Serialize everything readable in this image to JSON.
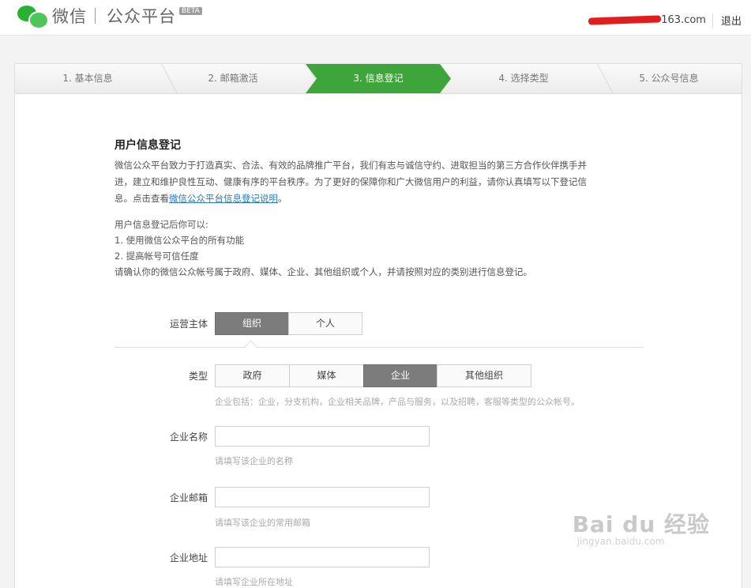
{
  "header": {
    "brand": "微信",
    "product": "公众平台",
    "beta": "BETA",
    "account_suffix": "163.com",
    "logout": "退出"
  },
  "steps": [
    {
      "label": "1. 基本信息",
      "active": false
    },
    {
      "label": "2. 邮箱激活",
      "active": false
    },
    {
      "label": "3. 信息登记",
      "active": true
    },
    {
      "label": "4. 选择类型",
      "active": false
    },
    {
      "label": "5. 公众号信息",
      "active": false
    }
  ],
  "intro": {
    "title": "用户信息登记",
    "para_line1": "微信公众平台致力于打造真实、合法、有效的品牌推广平台，我们有志与诚信守约、进取担当的第三方合作伙伴携手并",
    "para_line2": "进，建立和维护良性互动、健康有序的平台秩序。为了更好的保障你和广大微信用户的利益，请你认真填写以下登记信",
    "para_line3_pre": "息。点击查看",
    "para_link": "微信公众平台信息登记说明",
    "para_line3_post": "。",
    "list_intro": "用户信息登记后你可以:",
    "list_item1": "1. 使用微信公众平台的所有功能",
    "list_item2": "2. 提高帐号可信任度",
    "list_note": "请确认你的微信公众帐号属于政府、媒体、企业、其他组织或个人，并请按照对应的类别进行信息登记。"
  },
  "form": {
    "entity_label": "运营主体",
    "entity_options": [
      "组织",
      "个人"
    ],
    "entity_selected": "组织",
    "type_label": "类型",
    "type_options": [
      "政府",
      "媒体",
      "企业",
      "其他组织"
    ],
    "type_selected": "企业",
    "type_hint": "企业包括：企业，分支机构，企业相关品牌，产品与服务，以及招聘，客服等类型的公众帐号。",
    "company_name_label": "企业名称",
    "company_name_value": "",
    "company_name_hint": "请填写该企业的名称",
    "company_email_label": "企业邮箱",
    "company_email_value": "",
    "company_email_hint": "请填写该企业的常用邮箱",
    "company_address_label": "企业地址",
    "company_address_value": "",
    "company_address_hint": "请填写企业所在地址"
  },
  "watermark": {
    "big": "Bai du 经验",
    "small": "jingyan.baidu.com"
  }
}
